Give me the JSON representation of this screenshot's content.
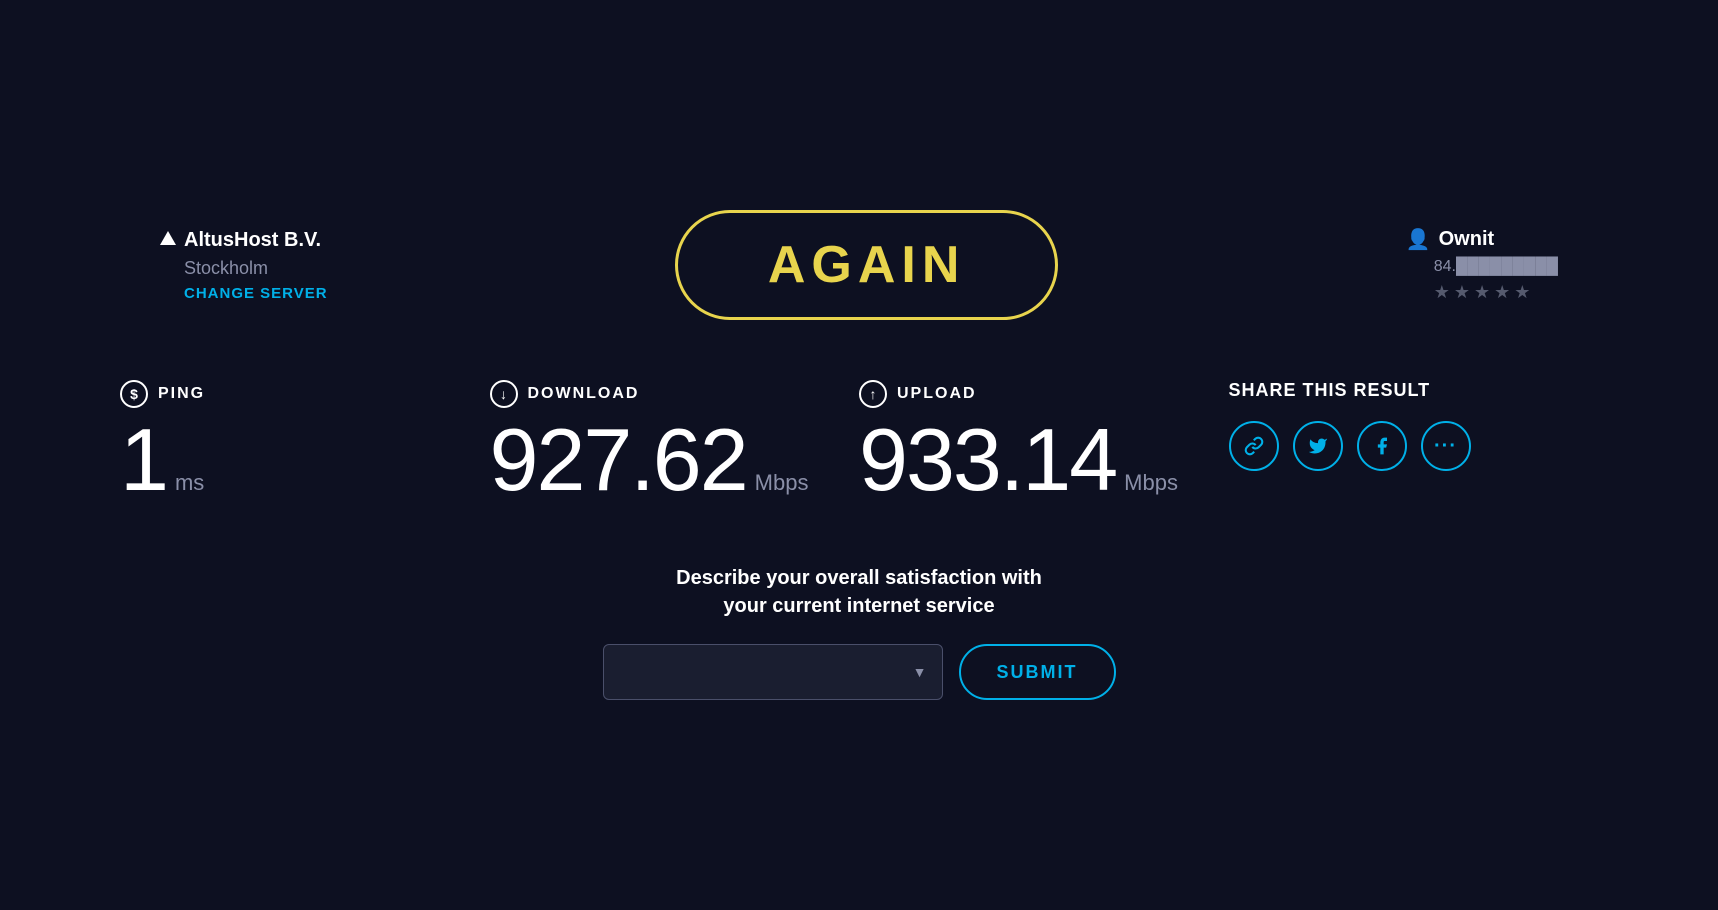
{
  "server": {
    "name": "AltusHost B.V.",
    "location": "Stockholm",
    "change_server_label": "CHANGE SERVER"
  },
  "again_button": {
    "label": "AGAIN"
  },
  "user": {
    "name": "Ownit",
    "ip": "84.█████████",
    "stars": [
      1,
      1,
      0,
      0,
      0
    ],
    "star_filled": "★",
    "star_empty": "★"
  },
  "stats": {
    "ping": {
      "icon": "$",
      "label": "PING",
      "value": "1",
      "unit": "ms"
    },
    "download": {
      "icon": "↓",
      "label": "DOWNLOAD",
      "value": "927.62",
      "unit": "Mbps"
    },
    "upload": {
      "icon": "↑",
      "label": "UPLOAD",
      "value": "933.14",
      "unit": "Mbps"
    }
  },
  "share": {
    "label": "SHARE THIS RESULT",
    "icons": [
      "🔗",
      "🐦",
      "f",
      "···"
    ]
  },
  "satisfaction": {
    "text_line1": "Describe your overall satisfaction with",
    "text_line2": "your current internet service",
    "select_placeholder": "",
    "submit_label": "SUBMIT"
  }
}
